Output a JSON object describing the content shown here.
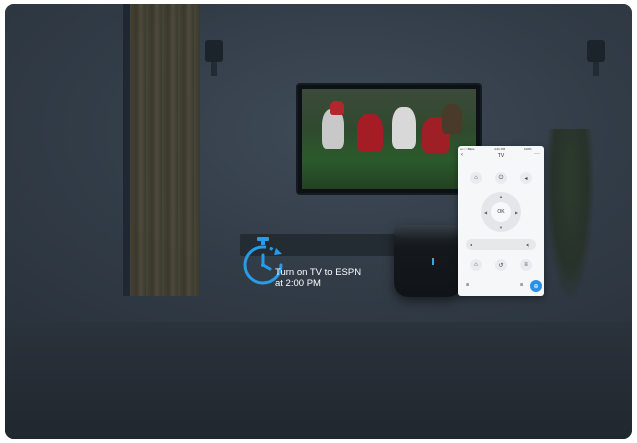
{
  "scene": {
    "timer_label_line1": "Turn on TV to ESPN",
    "timer_label_line2": "at 2:00 PM",
    "accent_color": "#2a8fe6"
  },
  "phone": {
    "title": "TV",
    "status_left": "•••○○ BELL",
    "status_time": "4:21 PM",
    "status_right": "100%",
    "ok_label": "OK",
    "icons": [
      "back-icon",
      "more-icon",
      "input-icon",
      "power-icon",
      "volume-icon",
      "dpad",
      "volume-down-icon",
      "volume-up-icon",
      "home-icon",
      "return-icon",
      "menu-icon",
      "grid-icon",
      "fab-icon"
    ]
  }
}
